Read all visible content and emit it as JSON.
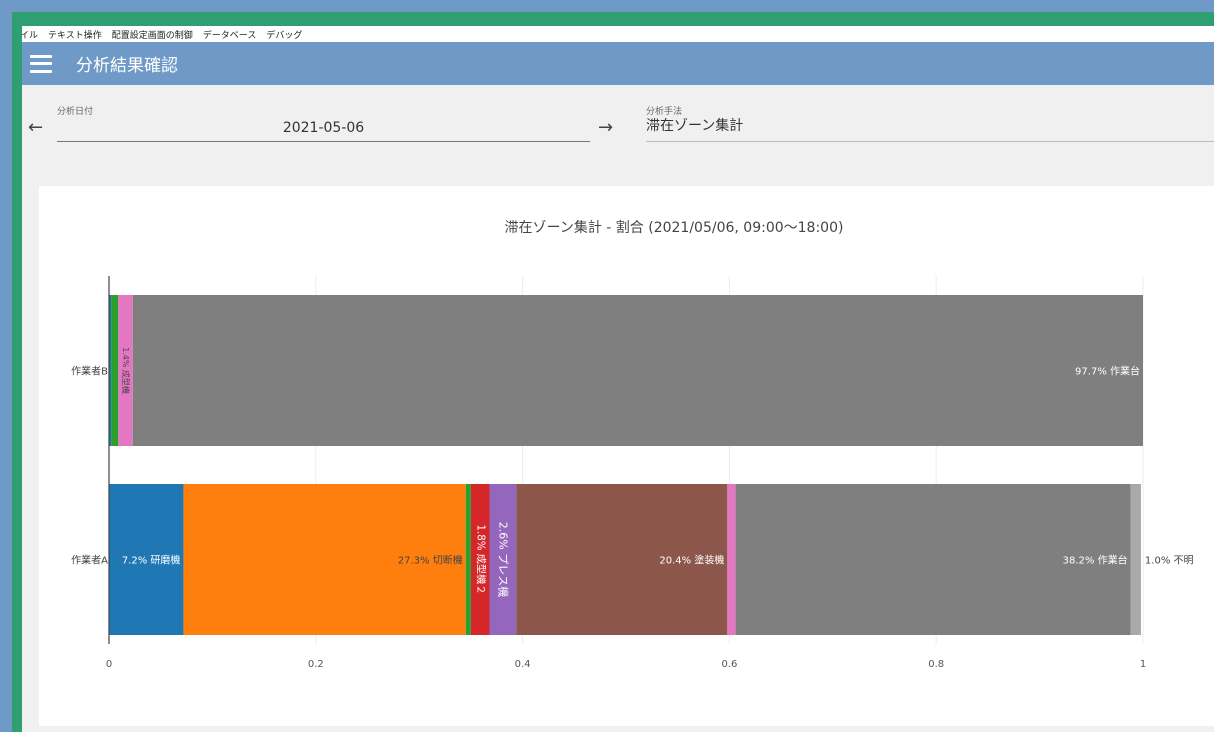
{
  "menu": [
    "ファイル",
    "テキスト操作",
    "配置設定画面の制御",
    "データベース",
    "デバッグ"
  ],
  "appbar": {
    "title": "分析結果確認",
    "menu_icon": "hamburger-menu-icon"
  },
  "date_field": {
    "label": "分析日付",
    "value": "2021-05-06",
    "prev_icon": "arrow-left-icon",
    "next_icon": "arrow-right-icon"
  },
  "method_field": {
    "label": "分析手法",
    "value": "滞在ゾーン集計"
  },
  "colors": {
    "appbar": "#6f9ac7",
    "frame": "#2f9e73"
  },
  "chart_data": {
    "type": "bar",
    "orientation": "horizontal",
    "stacked": true,
    "title": "滞在ゾーン集計 - 割合 (2021/05/06, 09:00〜18:00)",
    "xlim": [
      0,
      1
    ],
    "x_ticks": [
      "0",
      "0.2",
      "0.4",
      "0.6",
      "0.8",
      "1"
    ],
    "grid": true,
    "categories": [
      "作業者A",
      "作業者B"
    ],
    "rows": [
      {
        "name": "作業者A",
        "segments": [
          {
            "value": 0.072,
            "label": "7.2% 研磨機",
            "color": "#1f77b4",
            "text_color": "#ffffff",
            "vertical": false
          },
          {
            "value": 0.273,
            "label": "27.3% 切断機",
            "color": "#ff7f0e",
            "text_color": "#444444",
            "vertical": false
          },
          {
            "value": 0.005,
            "label": "",
            "color": "#2ca02c",
            "text_color": "#ffffff",
            "vertical": true
          },
          {
            "value": 0.018,
            "label": "1.8% 成型機２",
            "color": "#d62728",
            "text_color": "#ffffff",
            "vertical": true
          },
          {
            "value": 0.026,
            "label": "2.6% プレス機",
            "color": "#9467bd",
            "text_color": "#ffffff",
            "vertical": true
          },
          {
            "value": 0.204,
            "label": "20.4% 塗装機",
            "color": "#8c564b",
            "text_color": "#ffffff",
            "vertical": false
          },
          {
            "value": 0.008,
            "label": "",
            "color": "#e377c2",
            "text_color": "#ffffff",
            "vertical": true
          },
          {
            "value": 0.382,
            "label": "38.2% 作業台",
            "color": "#7f7f7f",
            "text_color": "#ffffff",
            "vertical": false
          },
          {
            "value": 0.01,
            "label": "1.0% 不明",
            "color": "#a9a9a9",
            "text_color": "#444444",
            "outside": true
          }
        ]
      },
      {
        "name": "作業者B",
        "segments": [
          {
            "value": 0.002,
            "label": "",
            "color": "#1f77b4",
            "text_color": "#ffffff",
            "vertical": true
          },
          {
            "value": 0.007,
            "label": "",
            "color": "#2ca02c",
            "text_color": "#ffffff",
            "vertical": true
          },
          {
            "value": 0.014,
            "label": "1.4% 成型機",
            "color": "#e377c2",
            "text_color": "#444444",
            "vertical": true
          },
          {
            "value": 0.977,
            "label": "97.7% 作業台",
            "color": "#7f7f7f",
            "text_color": "#ffffff",
            "vertical": false
          }
        ]
      }
    ]
  }
}
